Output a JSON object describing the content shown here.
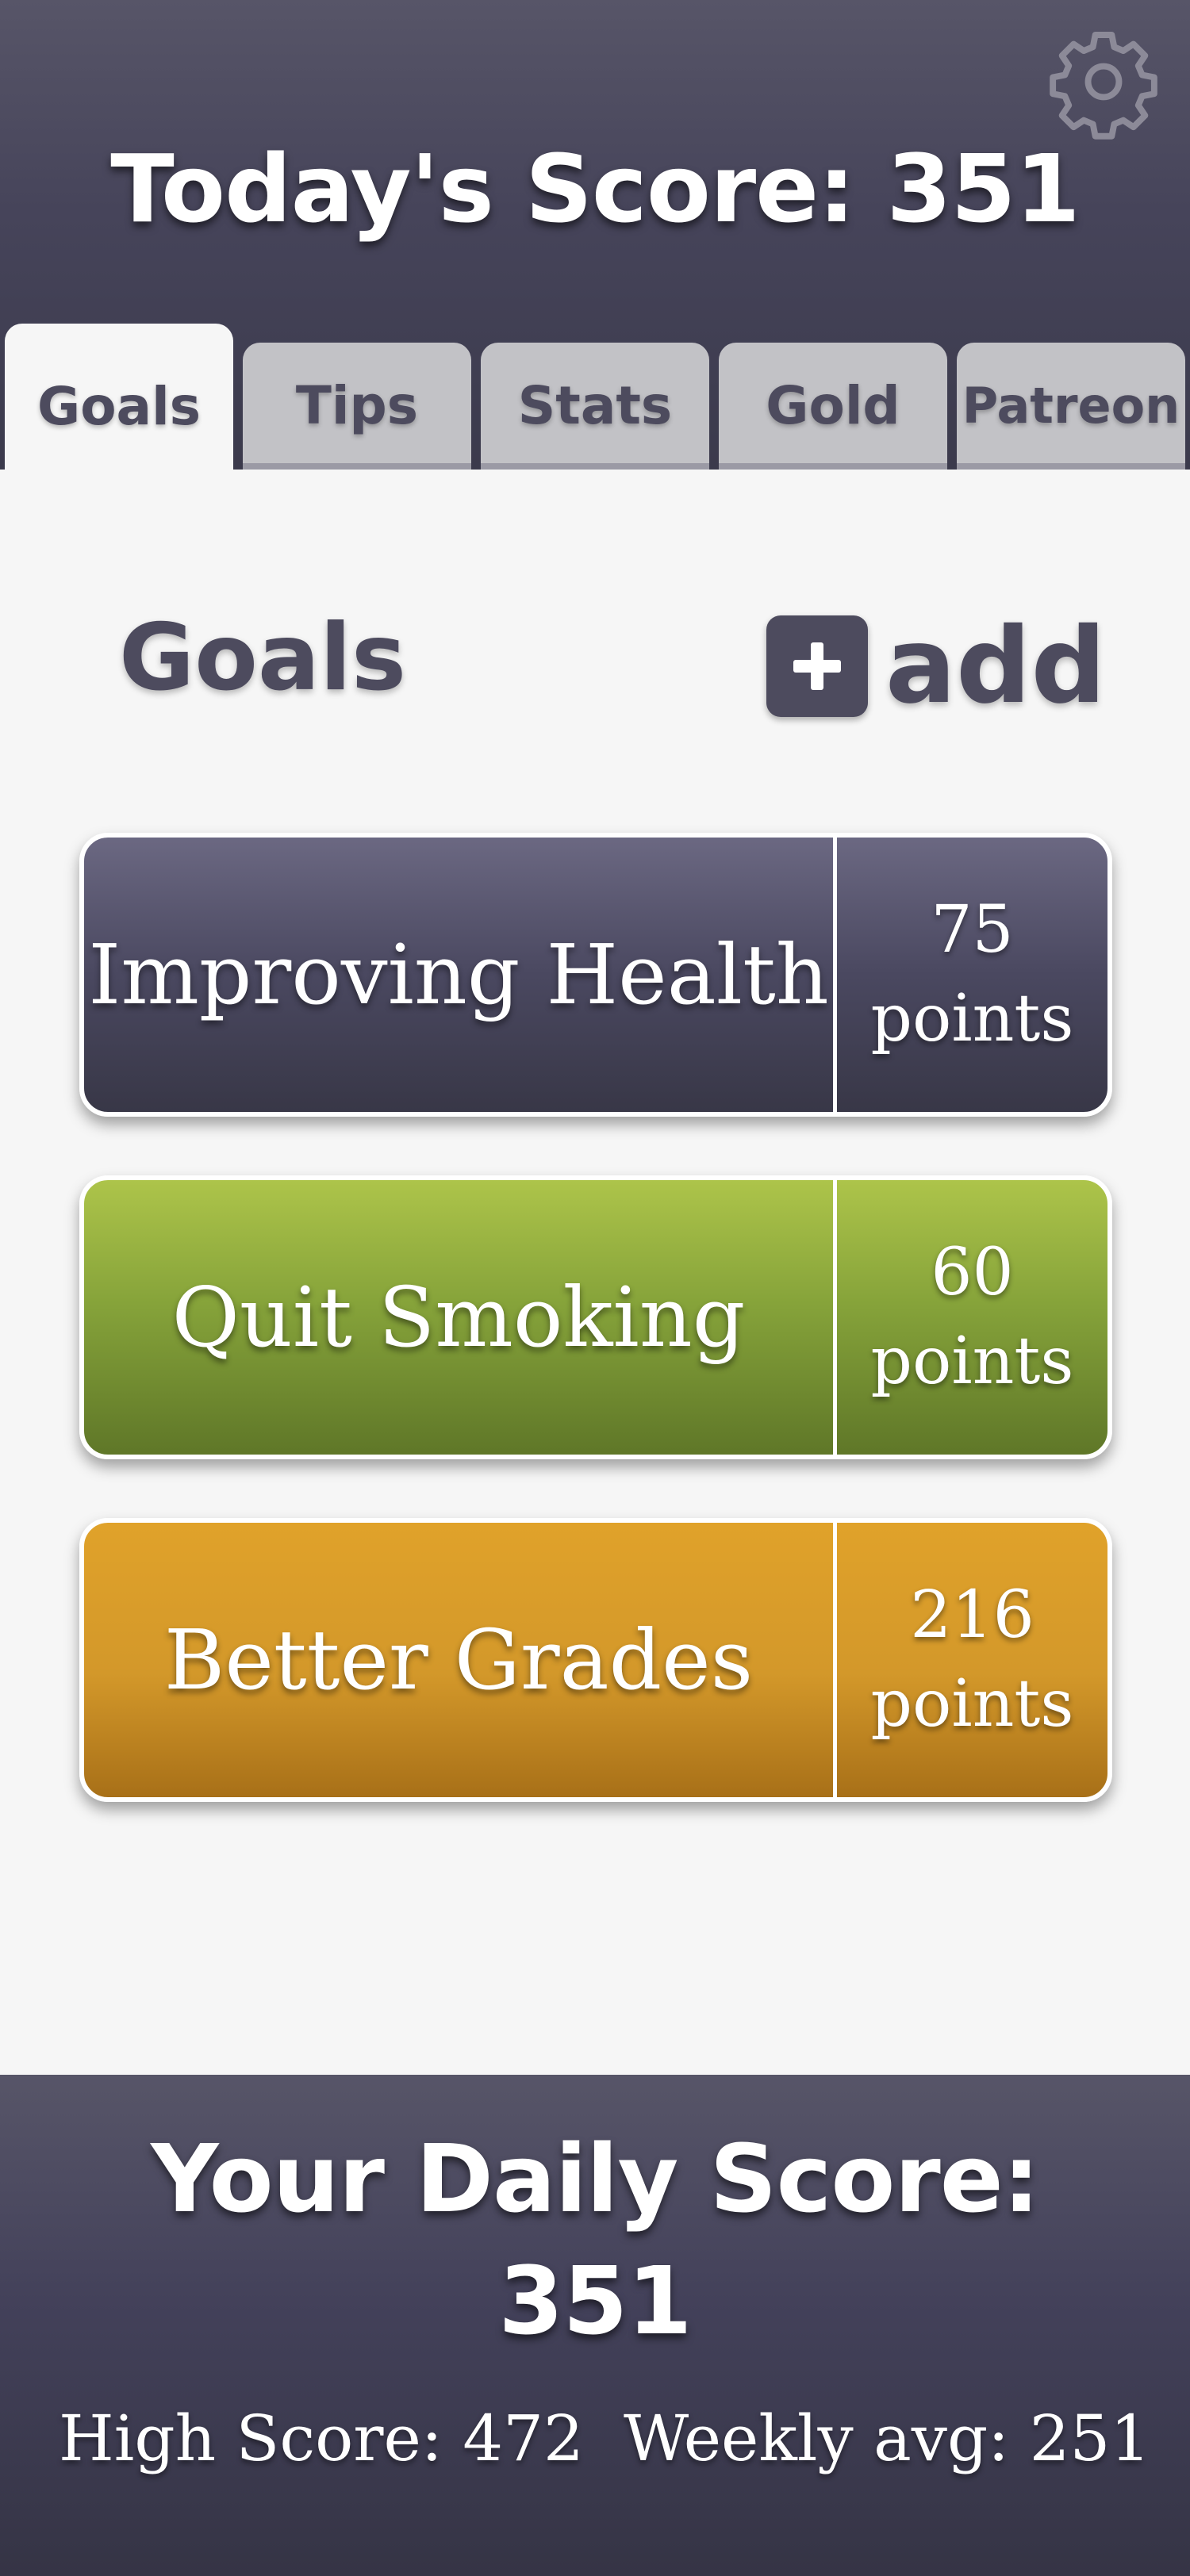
{
  "header": {
    "title": "Today's Score: 351",
    "settings_icon": "gear-icon"
  },
  "tabs": [
    {
      "label": "Goals",
      "active": true
    },
    {
      "label": "Tips",
      "active": false
    },
    {
      "label": "Stats",
      "active": false
    },
    {
      "label": "Gold",
      "active": false
    },
    {
      "label": "Patreon",
      "active": false
    }
  ],
  "goals_section": {
    "heading": "Goals",
    "add_label": "add",
    "add_icon": "plus-square-icon"
  },
  "goals": [
    {
      "name": "Improving Health",
      "points_value": "75",
      "points_unit": "points",
      "color": "#4a4860"
    },
    {
      "name": "Quit Smoking",
      "points_value": "60",
      "points_unit": "points",
      "color": "#86a33a"
    },
    {
      "name": "Better Grades",
      "points_value": "216",
      "points_unit": "points",
      "color": "#d3982a"
    }
  ],
  "footer": {
    "title_line1": "Your Daily Score:",
    "title_line2": "351",
    "high_score": "High Score: 472",
    "weekly_avg": "Weekly avg: 251"
  },
  "colors": {
    "header_bg": "#46445a",
    "tab_inactive": "#c2c2c6",
    "tab_text": "#4d4b5e",
    "page_bg": "#f6f6f6"
  }
}
